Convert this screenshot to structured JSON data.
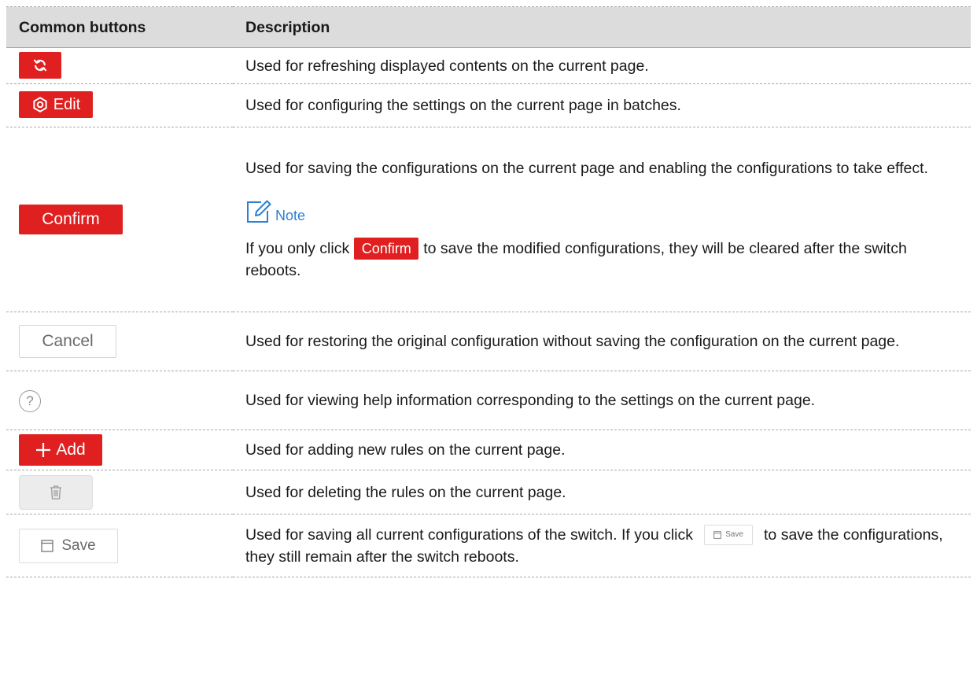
{
  "header": {
    "col1": "Common buttons",
    "col2": "Description"
  },
  "rows": [
    {
      "button": {
        "icon": "refresh-icon"
      },
      "description": "Used for refreshing displayed contents on the current page."
    },
    {
      "button": {
        "icon": "edit-icon",
        "label": "Edit"
      },
      "description": "Used for configuring the settings on the current page in batches."
    },
    {
      "button": {
        "label": "Confirm"
      },
      "description": "Used for saving the configurations on the current page and enabling the configurations to take effect.",
      "note": {
        "icon": "note-icon",
        "label": "Note",
        "text_before": "If you only click",
        "inline_button": "Confirm",
        "text_after": "to save the modified configurations, they will be cleared after the switch reboots."
      }
    },
    {
      "button": {
        "label": "Cancel"
      },
      "description": "Used for restoring the original configuration without saving the configuration on the current page."
    },
    {
      "button": {
        "icon": "help-icon",
        "label": "?"
      },
      "description": "Used for viewing help information corresponding to the settings on the current page."
    },
    {
      "button": {
        "icon": "plus-icon",
        "label": "Add"
      },
      "description": "Used for adding new rules on the current page."
    },
    {
      "button": {
        "icon": "trash-icon"
      },
      "description": "Used for deleting the rules on the current page."
    },
    {
      "button": {
        "icon": "save-icon",
        "label": "Save"
      },
      "description_before": "Used for saving all current configurations of the switch. If you click",
      "inline_button": "Save",
      "description_after": "to save the configurations, they still remain after the switch reboots."
    }
  ],
  "colors": {
    "accent": "#e02020",
    "note": "#2f7fd3",
    "header_bg": "#dcdcdc"
  }
}
